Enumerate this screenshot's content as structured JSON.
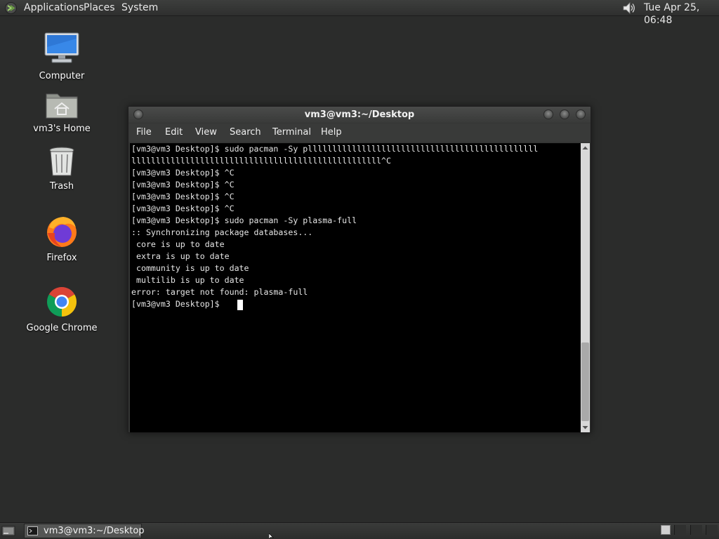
{
  "top_panel": {
    "menus": [
      "Applications",
      "Places",
      "System"
    ],
    "clock": "Tue Apr 25, 06:48",
    "icons": {
      "logo": "distro-logo-icon",
      "volume": "volume-icon"
    }
  },
  "desktop": {
    "icons": [
      {
        "label": "Computer",
        "icon": "computer-icon"
      },
      {
        "label": "vm3's Home",
        "icon": "home-folder-icon"
      },
      {
        "label": "Trash",
        "icon": "trash-icon"
      },
      {
        "label": "Firefox",
        "icon": "firefox-icon"
      },
      {
        "label": "Google Chrome",
        "icon": "chrome-icon"
      }
    ]
  },
  "terminal": {
    "title": "vm3@vm3:~/Desktop",
    "menu": [
      "File",
      "Edit",
      "View",
      "Search",
      "Terminal",
      "Help"
    ],
    "lines": [
      "[vm3@vm3 Desktop]$ sudo pacman -Sy plllllllllllllllllllllllllllllllllllllllllllllll",
      "lllllllllllllllllllllllllllllllllllllllllllllllllll^C",
      "[vm3@vm3 Desktop]$ ^C",
      "[vm3@vm3 Desktop]$ ^C",
      "[vm3@vm3 Desktop]$ ^C",
      "[vm3@vm3 Desktop]$ ^C",
      "[vm3@vm3 Desktop]$ sudo pacman -Sy plasma-full",
      ":: Synchronizing package databases...",
      " core is up to date",
      " extra is up to date",
      " community is up to date",
      " multilib is up to date",
      "error: target not found: plasma-full",
      "[vm3@vm3 Desktop]$ "
    ]
  },
  "taskbar": {
    "task_label": "vm3@vm3:~/Desktop",
    "colors": {
      "active_workspace": "#d0d0d0",
      "inactive_workspace": "#3a3b3a"
    }
  }
}
